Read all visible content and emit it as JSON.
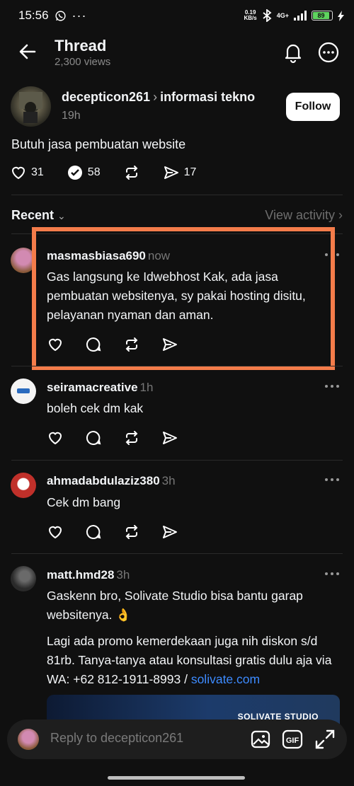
{
  "status_bar": {
    "time": "15:56",
    "net_speed_value": "0.19",
    "net_speed_unit": "KB/s",
    "network": "4G+",
    "battery": "89"
  },
  "header": {
    "title": "Thread",
    "views": "2,300 views"
  },
  "original_post": {
    "username": "decepticon261",
    "community": "informasi tekno",
    "time": "19h",
    "follow_label": "Follow",
    "text": "Butuh jasa pembuatan website",
    "likes": "31",
    "replies": "58",
    "shares": "17"
  },
  "sort": {
    "label": "Recent",
    "view_activity": "View activity"
  },
  "replies": [
    {
      "username": "masmasbiasa690",
      "time": "now",
      "text": "Gas langsung ke Idwebhost Kak, ada jasa pembuatan websitenya, sy pakai hosting disitu, pelayanan nyaman dan aman."
    },
    {
      "username": "seiramacreative",
      "time": "1h",
      "text": "boleh cek dm kak"
    },
    {
      "username": "ahmadabdulaziz380",
      "time": "3h",
      "text": "Cek dm bang"
    },
    {
      "username": "matt.hmd28",
      "time": "3h",
      "text": "Gaskenn bro, Solivate Studio bisa bantu garap websitenya. 👌",
      "text2": "Lagi ada promo kemerdekaan juga nih diskon s/d 81rb. Tanya-tanya atau konsultasi gratis dulu aja via WA: +62 812-1911-8993 / ",
      "link": "solivate.com",
      "preview_label": "SOLIVATE STUDIO"
    }
  ],
  "composer": {
    "placeholder": "Reply to decepticon261"
  },
  "colors": {
    "background": "#101010",
    "highlight": "#f47c4a",
    "link": "#3d8bff"
  }
}
